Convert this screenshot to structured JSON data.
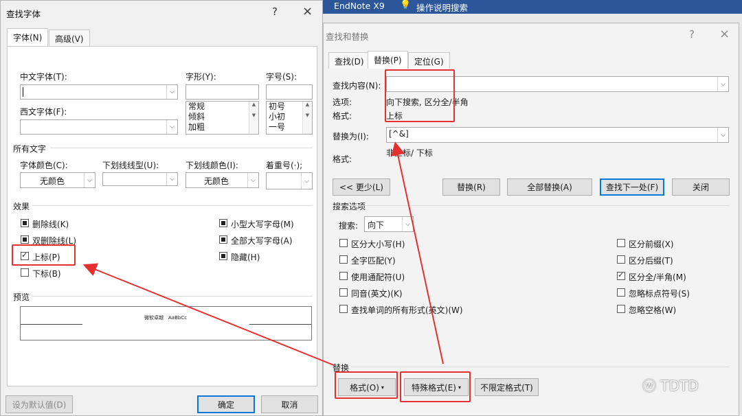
{
  "ribbon": {
    "app_name": "EndNote X9",
    "tell_me": "操作说明搜索"
  },
  "font_dialog": {
    "title": "查找字体",
    "help": "?",
    "close": "×",
    "tabs": [
      "字体(N)",
      "高级(V)"
    ],
    "chinese_font_label": "中文字体(T):",
    "western_font_label": "西文字体(F):",
    "style_label": "字形(Y):",
    "style_options": [
      "常规",
      "倾斜",
      "加粗"
    ],
    "size_label": "字号(S):",
    "size_options": [
      "初号",
      "小初",
      "一号"
    ],
    "all_text_label": "所有文字",
    "font_color_label": "字体颜色(C):",
    "font_color_value": "无颜色",
    "underline_type_label": "下划线线型(U):",
    "underline_color_label": "下划线颜色(I):",
    "underline_color_value": "无颜色",
    "emphasis_label": "着重号(·);",
    "effects_label": "效果",
    "effects": {
      "strikethrough": "删除线(K)",
      "double_strikethrough": "双删除线(L)",
      "superscript": "上标(P)",
      "subscript": "下标(B)",
      "small_caps": "小型大写字母(M)",
      "all_caps": "全部大写字母(A)",
      "hidden": "隐藏(H)"
    },
    "preview_label": "预览",
    "preview_text": "微软卓越　AaBbCc",
    "set_default": "设为默认值(D)",
    "ok": "确定",
    "cancel": "取消"
  },
  "replace_dialog": {
    "title": "查找和替换",
    "help": "?",
    "close": "×",
    "tabs": [
      "查找(D)",
      "替换(P)",
      "定位(G)"
    ],
    "find_label": "查找内容(N):",
    "find_value": "",
    "options_label": "选项:",
    "options_value": "向下搜索, 区分全/半角",
    "format_label": "格式:",
    "find_format_value": "上标",
    "replace_label": "替换为(I):",
    "replace_value": "[^&]",
    "replace_format_value": "非上标/ 下标",
    "less_button": "<< 更少(L)",
    "replace_button": "替换(R)",
    "replace_all_button": "全部替换(A)",
    "find_next_button": "查找下一处(F)",
    "close_button": "关闭",
    "search_options_label": "搜索选项",
    "search_label": "搜索:",
    "search_value": "向下",
    "left_options": [
      "区分大小写(H)",
      "全字匹配(Y)",
      "使用通配符(U)",
      "同音(英文)(K)",
      "查找单词的所有形式(英文)(W)"
    ],
    "right_options": [
      "区分前缀(X)",
      "区分后缀(T)",
      "区分全/半角(M)",
      "忽略标点符号(S)",
      "忽略空格(W)"
    ],
    "replace_section_label": "替换",
    "format_button": "格式(O)",
    "special_button": "特殊格式(E)",
    "no_format_button": "不限定格式(T)"
  },
  "watermark": "TDTD"
}
